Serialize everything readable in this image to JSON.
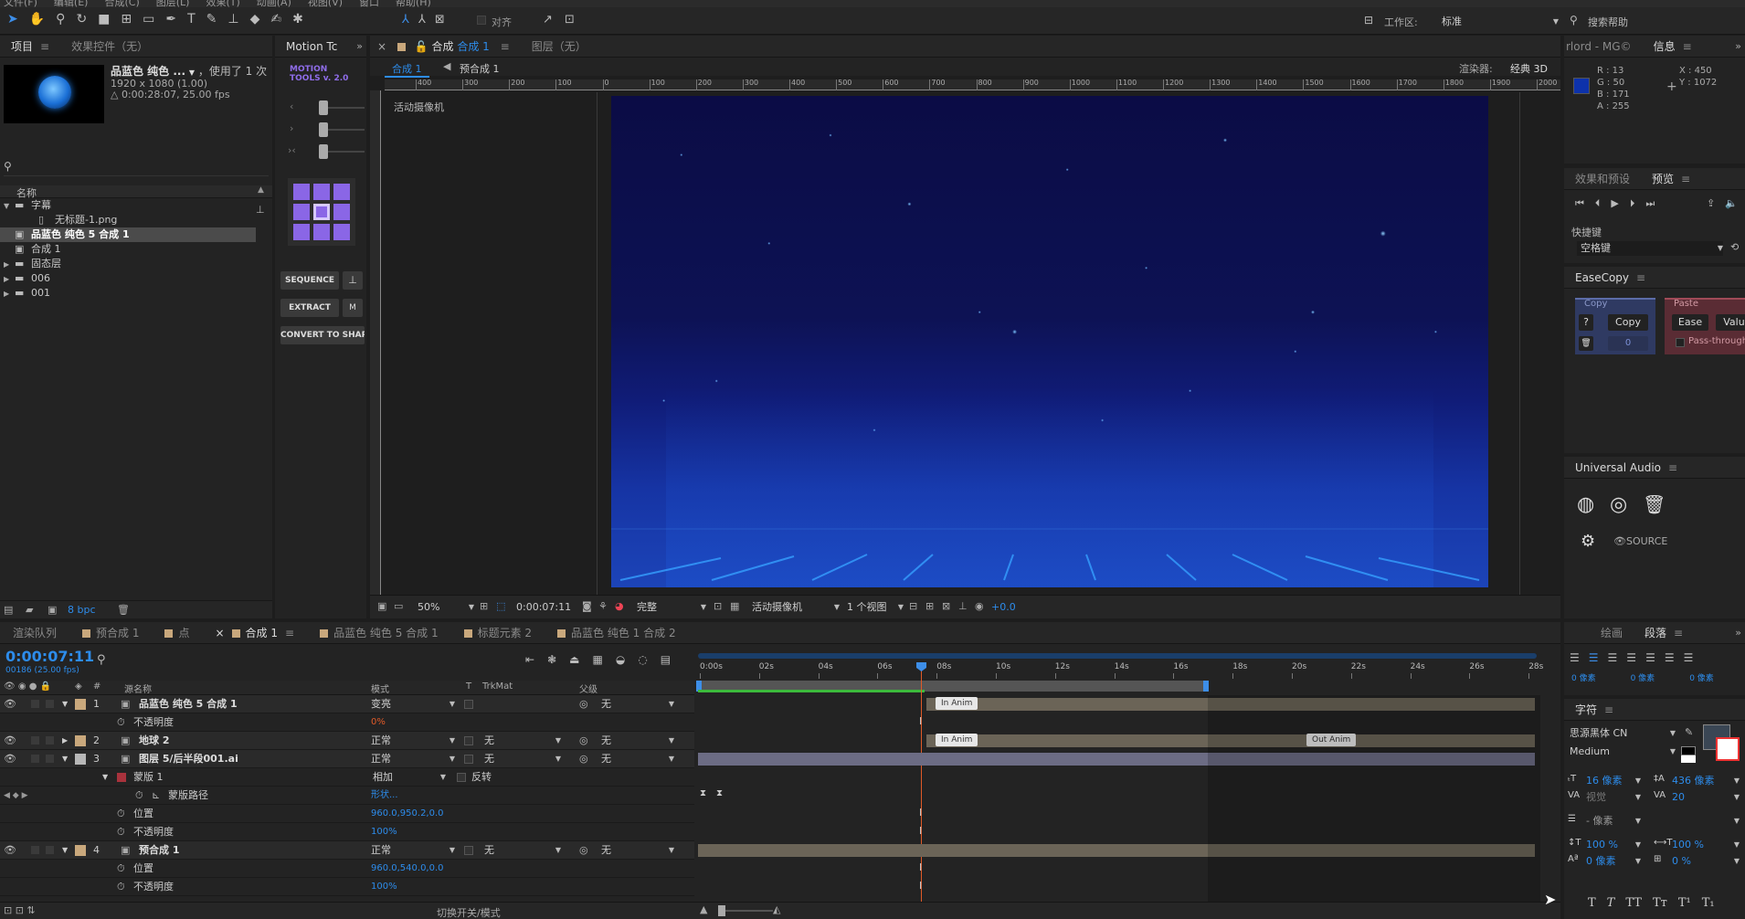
{
  "menubar": {
    "items": [
      "文件(F)",
      "编辑(E)",
      "合成(C)",
      "图层(L)",
      "效果(T)",
      "动画(A)",
      "视图(V)",
      "窗口",
      "帮助(H)"
    ]
  },
  "toolbar": {
    "align_label": "对齐",
    "workspace_label": "工作区:",
    "workspace_value": "标准",
    "search_help": "搜索帮助"
  },
  "project": {
    "tab_project": "项目",
    "tab_effects": "效果控件（无）",
    "item_name": "品蓝色 纯色 ...",
    "used": "，使用了 1 次",
    "size": "1920 x 1080 (1.00)",
    "duration": "△ 0:00:28:07, 25.00 fps",
    "col_name": "名称",
    "items": [
      {
        "label": "字幕",
        "type": "folder",
        "indent": 0,
        "open": true
      },
      {
        "label": "无标题-1.png",
        "type": "file",
        "indent": 1
      },
      {
        "label": "品蓝色 纯色 5 合成 1",
        "type": "comp",
        "indent": 0,
        "selected": true
      },
      {
        "label": "合成 1",
        "type": "comp",
        "indent": 0
      },
      {
        "label": "固态层",
        "type": "folder",
        "indent": 0
      },
      {
        "label": "006",
        "type": "folder",
        "indent": 0
      },
      {
        "label": "001",
        "type": "folder",
        "indent": 0
      }
    ],
    "bpc": "8 bpc"
  },
  "motion_tools": {
    "tab": "Motion Tc",
    "logo_1": "MOTION",
    "logo_2": "TOOLS v. 2.0",
    "btn_sequence": "SEQUENCE",
    "btn_extract": "EXTRACT",
    "btn_convert": "CONVERT TO SHAPE"
  },
  "comp_viewer": {
    "tab_comp_prefix": "合成",
    "tab_comp_name": "合成 1",
    "tab_layer": "图层（无）",
    "crumb_1": "合成 1",
    "crumb_2": "预合成 1",
    "renderer_label": "渲染器:",
    "renderer_value": "经典 3D",
    "camera_label": "活动摄像机",
    "ruler_labels": [
      "400",
      "300",
      "200",
      "100",
      "0",
      "100",
      "200",
      "300",
      "400",
      "500",
      "600",
      "700",
      "800",
      "900",
      "1000",
      "1100",
      "1200",
      "1300",
      "1400",
      "1500",
      "1600",
      "1700",
      "1800",
      "1900",
      "2000"
    ],
    "zoom": "50%",
    "timecode": "0:00:07:11",
    "resolution": "完整",
    "camera_select": "活动摄像机",
    "views": "1 个视图",
    "exposure": "+0.0"
  },
  "info": {
    "tab_1": "rlord - MG©",
    "tab_2": "信息",
    "r": "R : 13",
    "g": "G : 50",
    "b": "B : 171",
    "a": "A : 255",
    "x": "X : 450",
    "y": "Y : 1072",
    "color": "#0d32ab"
  },
  "preview": {
    "tab_effects": "效果和预设",
    "tab_preview": "预览",
    "shortcut_label": "快捷键",
    "shortcut_value": "空格键"
  },
  "easecopy": {
    "tab": "EaseCopy",
    "copy_header": "Copy",
    "paste_header": "Paste",
    "q": "?",
    "copy_btn": "Copy",
    "ease_btn": "Ease",
    "val_btn": "Valu",
    "zero": "0",
    "pass_through": "Pass-through"
  },
  "universal_audio": {
    "tab": "Universal Audio",
    "source": "SOURCE"
  },
  "timeline": {
    "tabs": [
      {
        "label": "渲染队列",
        "color": ""
      },
      {
        "label": "预合成 1",
        "color": "#c9a87c"
      },
      {
        "label": "点",
        "color": "#c9a87c"
      },
      {
        "label": "合成 1",
        "color": "#c9a87c",
        "active": true
      },
      {
        "label": "品蓝色 纯色 5 合成 1",
        "color": "#c9a87c"
      },
      {
        "label": "标题元素 2",
        "color": "#c9a87c"
      },
      {
        "label": "品蓝色 纯色 1 合成 2",
        "color": "#c9a87c"
      }
    ],
    "timecode": "0:00:07:11",
    "frames": "00186 (25.00 fps)",
    "col_source": "源名称",
    "col_mode": "模式",
    "col_t": "T",
    "col_trkmat": "TrkMat",
    "col_parent": "父级",
    "time_labels": [
      "0:00s",
      "02s",
      "04s",
      "06s",
      "08s",
      "10s",
      "12s",
      "14s",
      "16s",
      "18s",
      "20s",
      "22s",
      "24s",
      "26s",
      "28s"
    ],
    "rows": [
      {
        "num": "1",
        "name": "品蓝色 纯色 5 合成 1",
        "kind": "layer",
        "color": "#c9a87c",
        "mode": "变亮",
        "trk": "",
        "parent": "无",
        "bold": true
      },
      {
        "name": "不透明度",
        "kind": "prop",
        "value": "0%",
        "value_color": "#e05a28"
      },
      {
        "num": "2",
        "name": "地球 2",
        "kind": "layer",
        "color": "#c9a87c",
        "mode": "正常",
        "trk": "无",
        "parent": "无",
        "bold": true
      },
      {
        "num": "3",
        "name": "图层 5/后半段001.ai",
        "kind": "layer",
        "color": "#b8b8b8",
        "mode": "正常",
        "trk": "无",
        "parent": "无",
        "bold": true
      },
      {
        "name": "蒙版 1",
        "kind": "mask",
        "mode": "相加",
        "invert": "反转"
      },
      {
        "name": "蒙版路径",
        "kind": "prop2",
        "value": "形状..."
      },
      {
        "name": "位置",
        "kind": "prop",
        "value": "960.0,950.2,0.0"
      },
      {
        "name": "不透明度",
        "kind": "prop",
        "value": "100%"
      },
      {
        "num": "4",
        "name": "预合成 1",
        "kind": "layer",
        "color": "#c9a87c",
        "mode": "正常",
        "trk": "无",
        "parent": "无",
        "bold": true
      },
      {
        "name": "位置",
        "kind": "prop",
        "value": "960.0,540.0,0.0"
      },
      {
        "name": "不透明度",
        "kind": "prop",
        "value": "100%"
      }
    ],
    "marker_in": "In Anim",
    "marker_out": "Out Anim",
    "footer": "切换开关/模式"
  },
  "paragraph": {
    "tab_draw": "绘画",
    "tab_para": "段落",
    "px_1": "0 像素",
    "px_2": "0 像素",
    "px_3": "0 像素"
  },
  "character": {
    "tab": "字符",
    "font": "思源黑体 CN",
    "weight": "Medium",
    "size": "16 像素",
    "leading": "436 像素",
    "kerning": "视觉",
    "tracking": "20",
    "stroke": "- 像素",
    "v_scale": "100 %",
    "h_scale": "100 %",
    "baseline": "0 像素",
    "tsume": "0 %"
  }
}
